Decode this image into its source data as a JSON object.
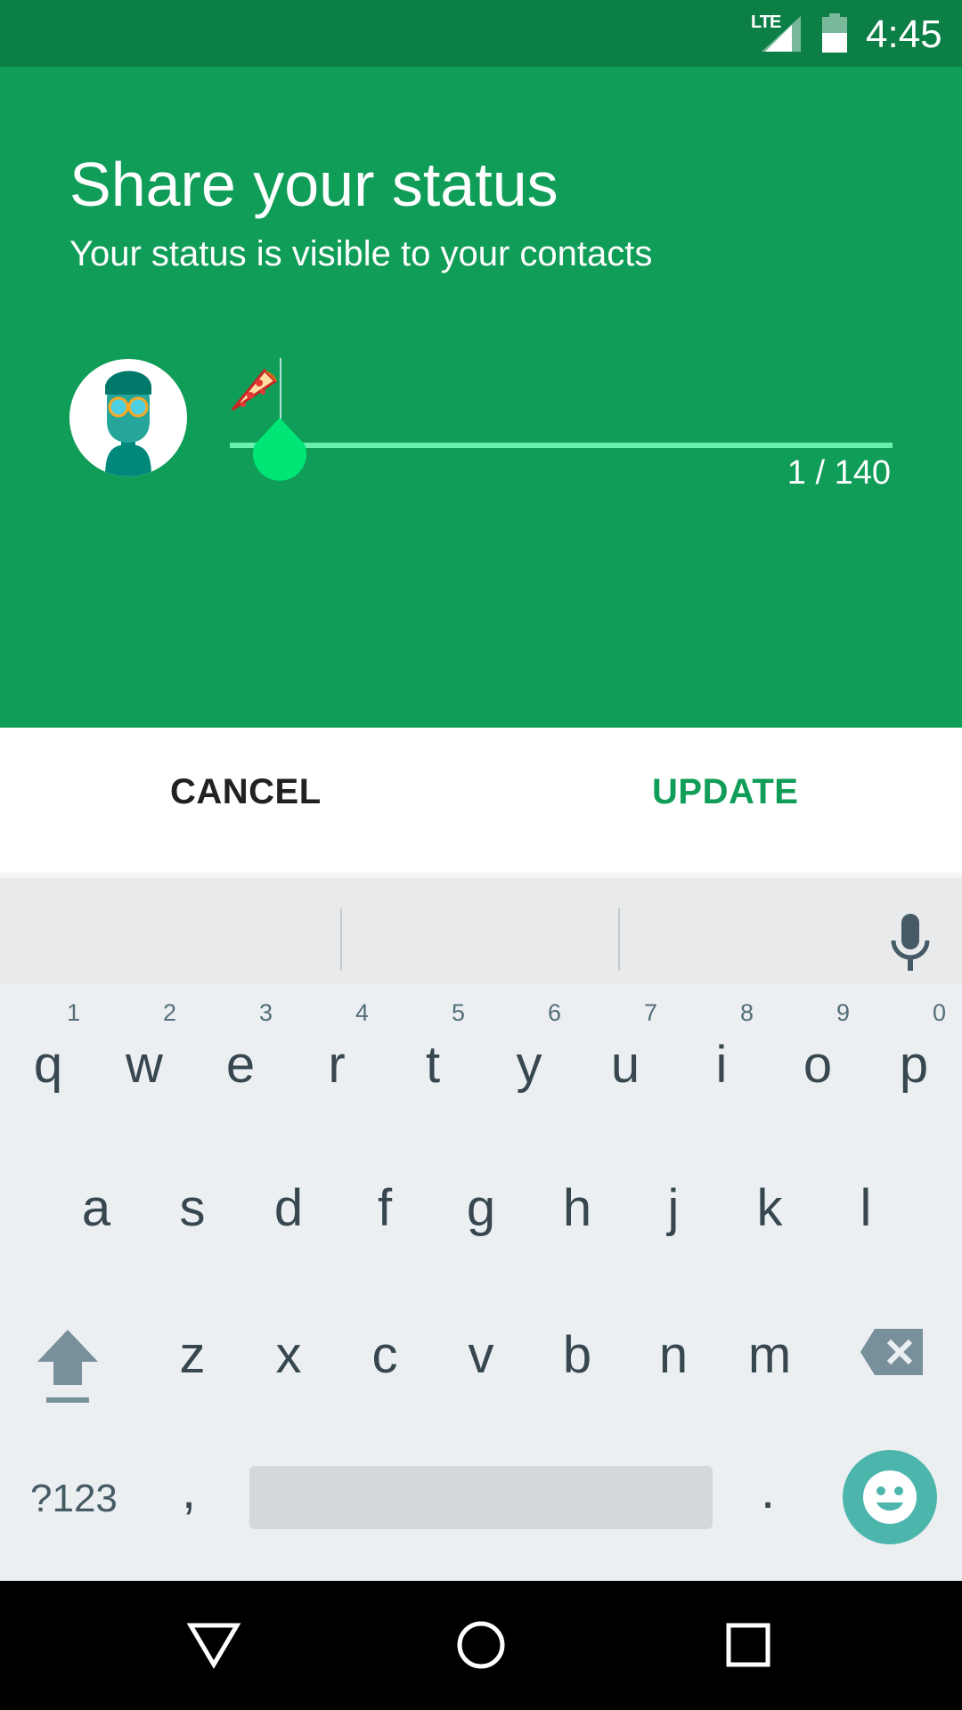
{
  "status_bar": {
    "network": "LTE",
    "time": "4:45"
  },
  "header": {
    "title": "Share your status",
    "subtitle": "Your status is visible to your contacts",
    "counter": "1 / 140",
    "status_emoji": "pizza-emoji"
  },
  "actions": {
    "cancel": "CANCEL",
    "update": "UPDATE"
  },
  "colors": {
    "primary": "#0f9d58",
    "status_bar": "#0b7f45",
    "accent": "#69f0ae",
    "emoji_button": "#4db6ac"
  },
  "keyboard": {
    "row1": [
      {
        "k": "q",
        "n": "1"
      },
      {
        "k": "w",
        "n": "2"
      },
      {
        "k": "e",
        "n": "3"
      },
      {
        "k": "r",
        "n": "4"
      },
      {
        "k": "t",
        "n": "5"
      },
      {
        "k": "y",
        "n": "6"
      },
      {
        "k": "u",
        "n": "7"
      },
      {
        "k": "i",
        "n": "8"
      },
      {
        "k": "o",
        "n": "9"
      },
      {
        "k": "p",
        "n": "0"
      }
    ],
    "row2": [
      "a",
      "s",
      "d",
      "f",
      "g",
      "h",
      "j",
      "k",
      "l"
    ],
    "row3": [
      "z",
      "x",
      "c",
      "v",
      "b",
      "n",
      "m"
    ],
    "symbols": "?123",
    "comma": ",",
    "period": "."
  },
  "nav": [
    "back-icon",
    "home-icon",
    "recents-icon"
  ]
}
